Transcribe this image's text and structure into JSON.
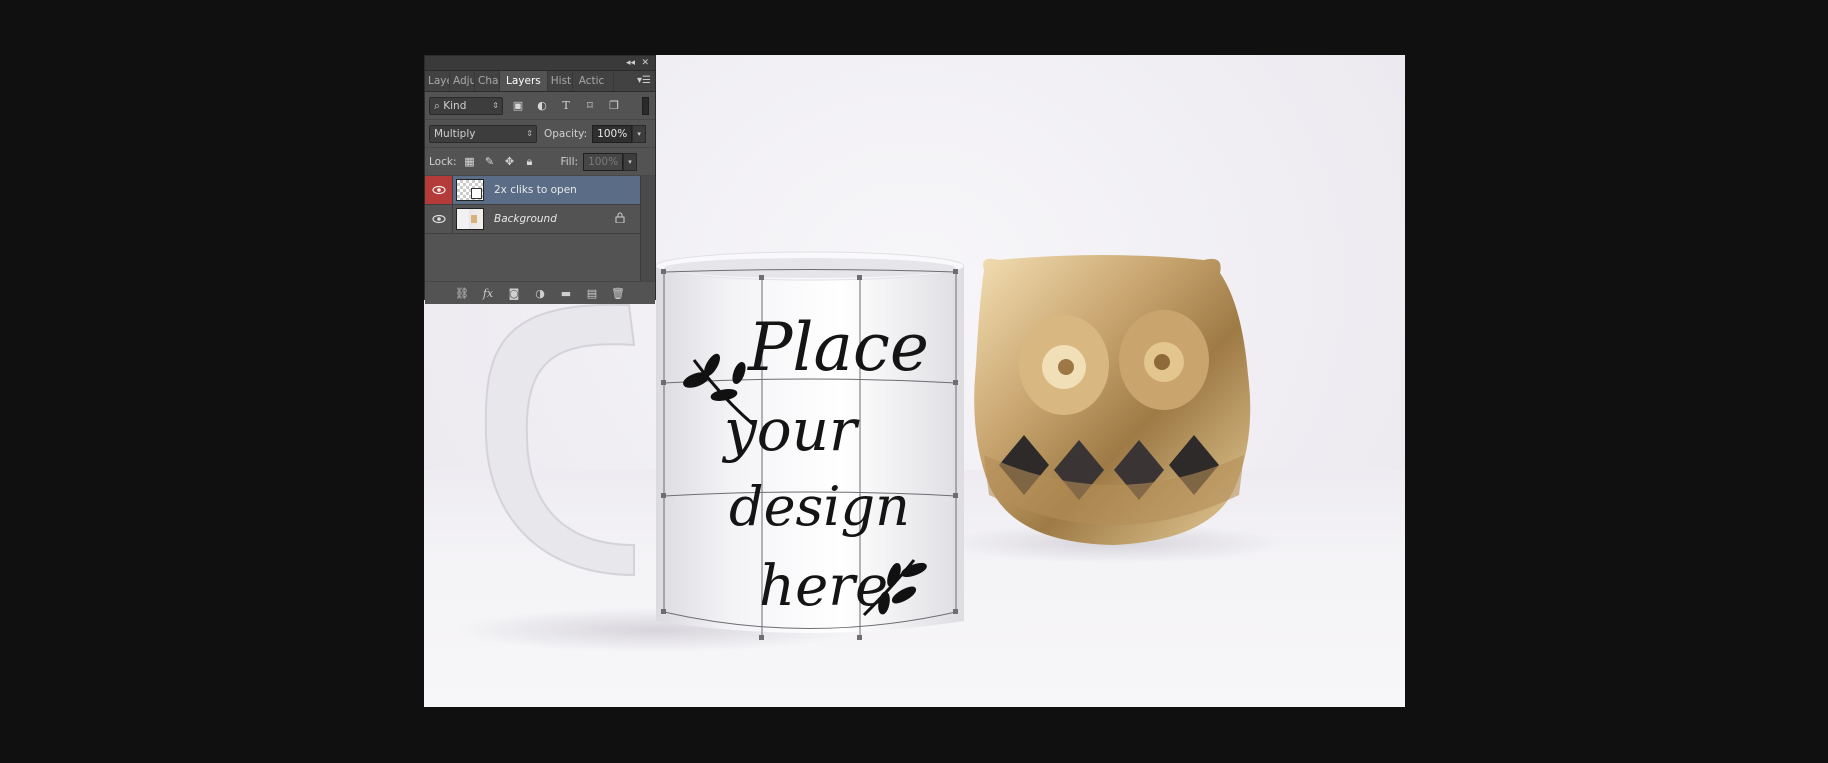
{
  "panel": {
    "tabs": [
      {
        "label": "Laye",
        "active": false
      },
      {
        "label": "Adju",
        "active": false
      },
      {
        "label": "Cha",
        "active": false
      },
      {
        "label": "Layers",
        "active": true
      },
      {
        "label": "Hist",
        "active": false
      },
      {
        "label": "Actic",
        "active": false
      }
    ],
    "filter": {
      "label": "Kind"
    },
    "blend_mode": "Multiply",
    "opacity_label": "Opacity:",
    "opacity_value": "100%",
    "lock_label": "Lock:",
    "fill_label": "Fill:",
    "fill_value": "100%",
    "layers": [
      {
        "name": "2x cliks to open",
        "selected": true,
        "visible": true
      },
      {
        "name": "Background",
        "selected": false,
        "visible": true,
        "locked": true
      }
    ],
    "bottom_icons": [
      "link-icon",
      "fx-icon",
      "mask-icon",
      "adjustment-icon",
      "folder-icon",
      "new-layer-icon",
      "trash-icon"
    ]
  },
  "canvas": {
    "design_text": [
      "Place",
      "your",
      "design",
      "here"
    ]
  },
  "colors": {
    "panel_bg": "#535353",
    "selected_layer": "#5a6c86",
    "eye_selected": "#b53a3a",
    "workspace_bg": "#101010",
    "gold": "#c9a570"
  }
}
